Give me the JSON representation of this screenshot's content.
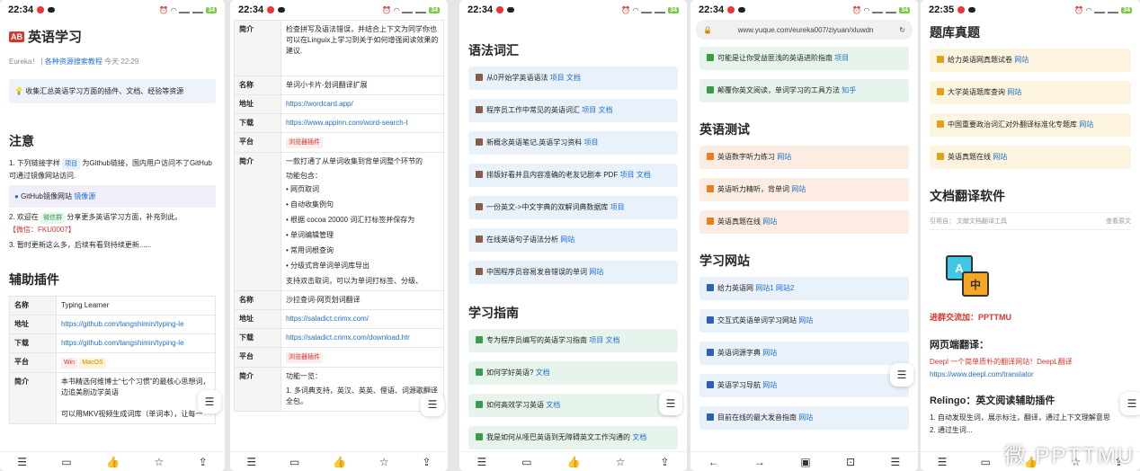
{
  "status": {
    "p1_time": "22:34",
    "p2_time": "22:34",
    "p3_time": "22:34",
    "p4_time": "22:34",
    "p5_time": "22:35",
    "battery": "34"
  },
  "colors": {
    "accent": "#1f6fd1",
    "red": "#d6372f"
  },
  "p1": {
    "title": "英语学习",
    "title_icon": "AB",
    "meta": {
      "author": "Eureka！",
      "repo": "各种资源搜索教程",
      "time": "今天 22:29"
    },
    "note": "收集汇总英语学习方面的插件、文档、经验等资源",
    "section_notice": "注意",
    "list1_a": "1. 下列链接字样",
    "list1_tag": "项目",
    "list1_b": "为Github链接，国内用户访问不了GitHub可通过镜像网站访问.",
    "mirror_label": "GitHub镜像网站",
    "mirror_link": "镜像源",
    "list2_a": "2. 欢迎在",
    "list2_tag": "微信群",
    "list2_b": "分享更多英语学习方面，补充到此。",
    "list2_c": "【微信：FKU0007】",
    "list3": "3. 暂时更新这么多，后续有看到持续更新......",
    "section_plugins": "辅助插件",
    "rows": [
      {
        "k": "名称",
        "v": "Typing Learner"
      },
      {
        "k": "地址",
        "v": "https://github.com/tangshimin/typing-le"
      },
      {
        "k": "下载",
        "v": "https://github.com/tangshimin/typing-le"
      },
      {
        "k": "平台",
        "v1": "Win",
        "v2": "MacOS"
      },
      {
        "k": "简介",
        "v": "本书精选何维博士“七个习惯”的最核心思想词，边追美剧边学英语",
        "v_extra": "可以用MKV视频生成词库（单词本），让每一"
      }
    ]
  },
  "p2": {
    "rows": [
      {
        "k": "简介",
        "v": "检查拼写及语法错误，并结合上下文为同学你也可以在Linguix上学习到关于如何增强阅读效果的建议."
      },
      {
        "k": "名称",
        "v": "单词小卡片-划词翻译扩展"
      },
      {
        "k": "地址",
        "v": "https://wordcard.app/"
      },
      {
        "k": "下载",
        "v": "https://www.appinn.com/word-search-t"
      },
      {
        "k": "平台",
        "v": "浏览器插件"
      },
      {
        "k": "简介",
        "v": "一款打通了从单词收集到背单词整个环节的",
        "func": "功能包含：",
        "bullets": [
          "网页取词",
          "自动收集例句",
          "根据 cocoa 20000 词汇打标签并保存为",
          "单词编辑管理",
          "常用词根查询",
          "分级式背单词单词库导出"
        ],
        "tail": "支持双击取词，可以为单词打标签、分级、"
      },
      {
        "k": "名称",
        "v": "沙拉查词-网页划词翻译"
      },
      {
        "k": "地址",
        "v": "https://saladict.crimx.com/"
      },
      {
        "k": "下载",
        "v": "https://saladict.crimx.com/download.htr"
      },
      {
        "k": "平台",
        "v": "浏览器插件"
      },
      {
        "k": "简介",
        "v": "功能一览：",
        "v2": "1. 多词典支持，英汉、英英、俚语、词源歌翻译全包。"
      }
    ]
  },
  "p3": {
    "sec1": "语法词汇",
    "items1": [
      {
        "t": "从0开始学英语语法",
        "l1": "项目",
        "l2": "文档"
      },
      {
        "t": "程序员工作中常见的英语词汇",
        "l1": "项目",
        "l2": "文档"
      },
      {
        "t": "新概念英语笔记,英语学习资料",
        "l1": "项目",
        "l2": ""
      },
      {
        "t": "排版好看并且内容准确的老友记剧本 PDF",
        "l1": "项目",
        "l2": "文档"
      },
      {
        "t": "一份英文->中文字典的双解词典数据库",
        "l1": "项目",
        "l2": ""
      },
      {
        "t": "在线英语句子语法分析",
        "l1": "网站",
        "l2": ""
      },
      {
        "t": "中国程序员容易发音错误的单词",
        "l1": "网站",
        "l2": ""
      }
    ],
    "sec2": "学习指南",
    "items2": [
      {
        "t": "专为程序员编写的英语学习指南",
        "l1": "项目",
        "l2": "文档"
      },
      {
        "t": "如何学好英语?",
        "l1": "文档",
        "l2": ""
      },
      {
        "t": "如何高效学习英语",
        "l1": "文档",
        "l2": ""
      },
      {
        "t": "我是如何从哑巴英语到无障碍英文工作沟通的",
        "l1": "文档",
        "l2": ""
      }
    ]
  },
  "p4": {
    "url": "www.yuque.com/eureka007/ziyuan/xluwdn",
    "items0": [
      {
        "t": "可能是让你受益匪浅的英语进阶指南",
        "l1": "项目"
      },
      {
        "t": "颠覆你英文阅读，单词学习的工具方法",
        "l1": "知乎"
      }
    ],
    "sec1": "英语测试",
    "items1": [
      {
        "t": "英语数字听力练习",
        "l1": "网站"
      },
      {
        "t": "英语听力精听，背单词",
        "l1": "网站"
      },
      {
        "t": "英语真题在线",
        "l1": "网站"
      }
    ],
    "sec2": "学习网站",
    "items2": [
      {
        "t": "给力英语网",
        "l1": "网站1",
        "l2": "网站2"
      },
      {
        "t": "交互式英语单词学习网站",
        "l1": "网站"
      },
      {
        "t": "英语词源字典",
        "l1": "网站"
      },
      {
        "t": "英语学习导航",
        "l1": "网站"
      },
      {
        "t": "目前在线的最大发音指南",
        "l1": "网站"
      }
    ]
  },
  "p5": {
    "sec1": "题库真题",
    "items1": [
      {
        "t": "给力英语网真题试卷",
        "l1": "网站"
      },
      {
        "t": "大学英语题库查询",
        "l1": "网站"
      },
      {
        "t": "中国重要政治词汇对外翻译标准化专题库",
        "l1": "网站"
      },
      {
        "t": "英语真题在线",
        "l1": "网站"
      }
    ],
    "sec2": "文档翻译软件",
    "quote_label": "引用自：",
    "quote_src": "文献文档翻译工具",
    "quote_view": "查看原文",
    "icon_a": "A",
    "icon_b": "中",
    "group": "进群交流加：PPTTMU",
    "web_title": "网页端翻译：",
    "deepl_desc": "Deepl 一个简单质朴的翻译网站！DeepL翻译",
    "deepl_url": "https://www.deepl.com/translator",
    "relingo_title": "Relingo：英文阅读辅助插件",
    "relingo_1": "1. 自动发现生词，展示标注，翻译，通过上下文理解意思",
    "relingo_2": "2. 通过生词..."
  },
  "watermark": "微 PPTTMU"
}
